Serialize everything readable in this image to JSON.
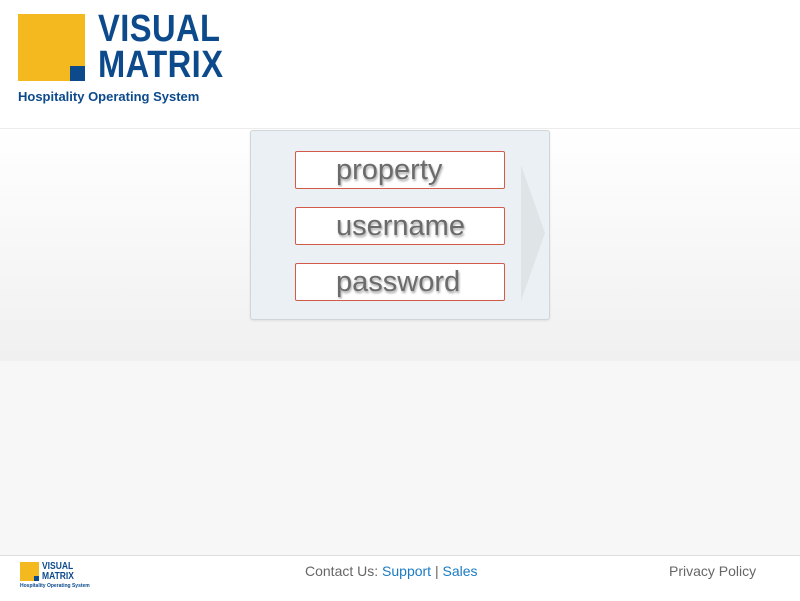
{
  "brand": {
    "word1": "VISUAL",
    "word2": "MATRIX",
    "tagline": "Hospitality Operating System",
    "colors": {
      "primary": "#0c4a8c",
      "accent": "#f3b91f"
    }
  },
  "login": {
    "property_placeholder": "property",
    "username_placeholder": "username",
    "password_placeholder": "password",
    "submit_icon": "submit-arrow-icon"
  },
  "footer": {
    "contact_prefix": "Contact Us:",
    "support_label": "Support",
    "separator": "|",
    "sales_label": "Sales",
    "privacy_label": "Privacy Policy",
    "link_color": "#1a7bc4"
  }
}
